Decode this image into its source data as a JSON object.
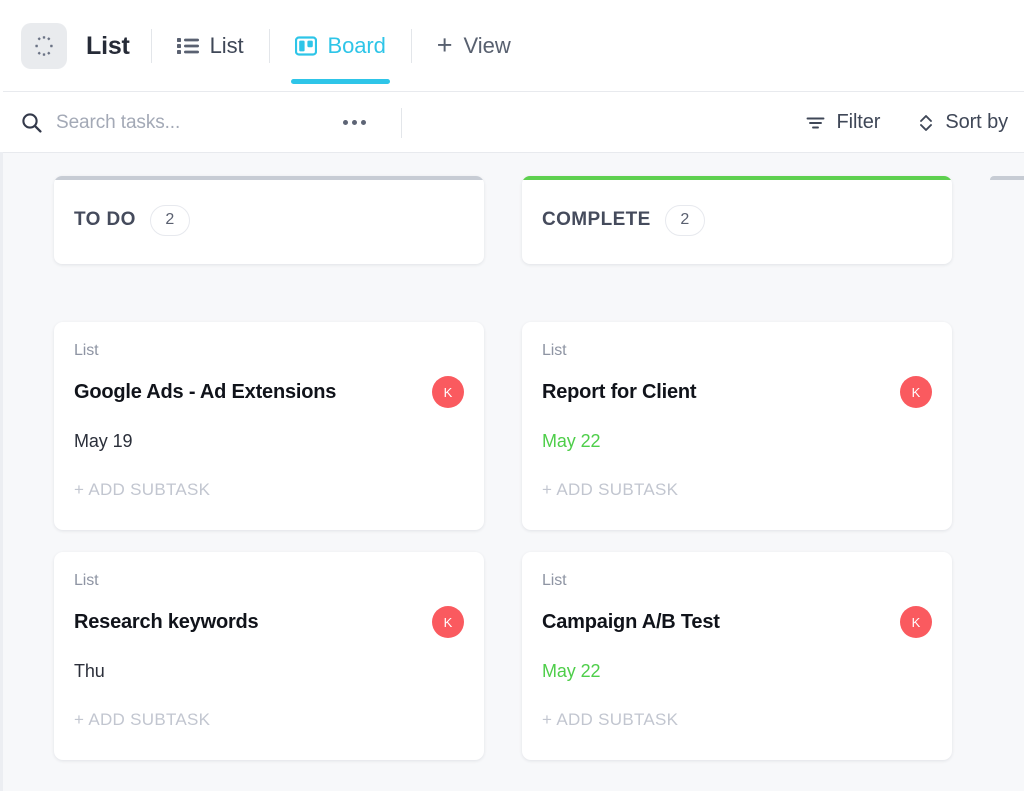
{
  "header": {
    "list_icon": "dotted-circle-icon",
    "title": "List",
    "tabs": [
      {
        "label": "List",
        "icon": "list-view-icon",
        "active": false
      },
      {
        "label": "Board",
        "icon": "board-view-icon",
        "active": true
      }
    ],
    "add_view": {
      "label": "View",
      "icon": "plus-icon"
    }
  },
  "toolbar": {
    "search": {
      "icon": "search-icon",
      "placeholder": "Search tasks...",
      "value": ""
    },
    "more_icon": "ellipsis-icon",
    "filter": {
      "label": "Filter",
      "icon": "filter-icon"
    },
    "sort": {
      "label": "Sort by",
      "icon": "sort-chevrons-icon"
    }
  },
  "board": {
    "columns": [
      {
        "title": "TO DO",
        "count": "2",
        "accent": "#c7ccd4",
        "cards": [
          {
            "list_label": "List",
            "title": "Google Ads - Ad Extensions",
            "date": "May 19",
            "date_state": "normal",
            "avatar": "K",
            "avatar_color": "#fa5a5f",
            "add_subtask": "+ ADD SUBTASK"
          },
          {
            "list_label": "List",
            "title": "Research keywords",
            "date": "Thu",
            "date_state": "normal",
            "avatar": "K",
            "avatar_color": "#fa5a5f",
            "add_subtask": "+ ADD SUBTASK"
          }
        ]
      },
      {
        "title": "COMPLETE",
        "count": "2",
        "accent": "#5ed04f",
        "cards": [
          {
            "list_label": "List",
            "title": "Report for Client",
            "date": "May 22",
            "date_state": "green",
            "avatar": "K",
            "avatar_color": "#fa5a5f",
            "add_subtask": "+ ADD SUBTASK"
          },
          {
            "list_label": "List",
            "title": "Campaign A/B Test",
            "date": "May 22",
            "date_state": "green",
            "avatar": "K",
            "avatar_color": "#fa5a5f",
            "add_subtask": "+ ADD SUBTASK"
          }
        ]
      },
      {
        "title": "",
        "count": "",
        "accent": "#c7ccd4",
        "partial": true,
        "cards": []
      }
    ]
  },
  "colors": {
    "accent_cyan": "#2ec5e8",
    "complete_green": "#5ed04f",
    "due_green": "#4ece4a",
    "avatar_red": "#fa5a5f",
    "board_bg": "#f7f8fa"
  }
}
